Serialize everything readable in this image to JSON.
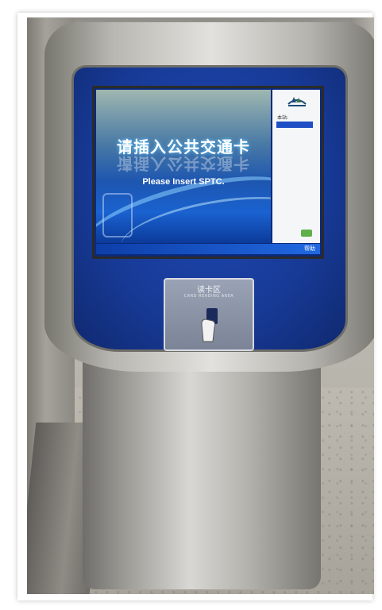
{
  "screen": {
    "title_cn": "请插入公共交通卡",
    "title_en": "Please Insert SPTC.",
    "station_label": "本站:",
    "help_label": "帮助"
  },
  "card_reader": {
    "title": "读卡区",
    "subtitle": "CARD READING AREA"
  },
  "colors": {
    "panel_blue": "#173a96",
    "screen_blue": "#1d56b0",
    "steel": "#b8b6b0"
  },
  "icons": [
    "logo-icon",
    "help-button-icon",
    "hand-card-icon"
  ]
}
